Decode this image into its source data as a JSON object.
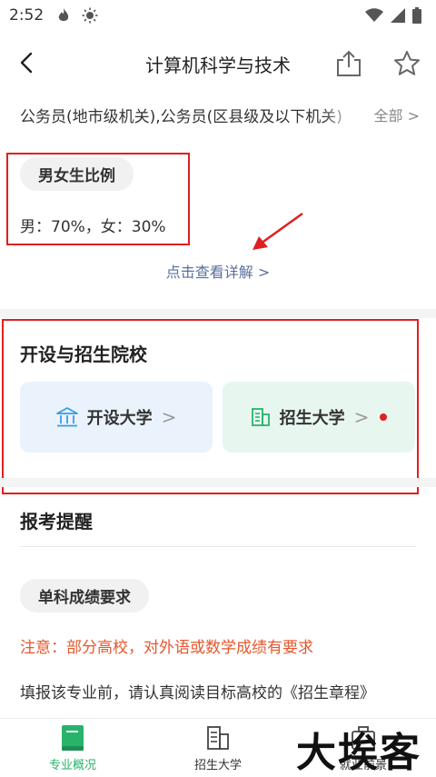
{
  "status_bar": {
    "time": "2:52"
  },
  "header": {
    "title": "计算机科学与技术"
  },
  "career": {
    "text": "公务员(地市级机关),公务员(区县级及以下机关)",
    "all_label": "全部 >"
  },
  "gender": {
    "title": "男女生比例",
    "ratio": "男：70%，女：30%",
    "detail_link": "点击查看详解 >"
  },
  "schools": {
    "title": "开设与招生院校",
    "open_label": "开设大学",
    "enroll_label": "招生大学",
    "chevron": ">"
  },
  "reminder": {
    "title": "报考提醒",
    "subject_pill": "单科成绩要求",
    "notice": "注意：部分高校，对外语或数学成绩有要求",
    "read": "填报该专业前，请认真阅读目标高校的《招生章程》"
  },
  "bottom_nav": {
    "items": [
      {
        "label": "专业概况",
        "icon": "book-icon",
        "active": true
      },
      {
        "label": "招生大学",
        "icon": "building-icon",
        "active": false
      },
      {
        "label": "就业前景",
        "icon": "briefcase-icon",
        "active": false
      }
    ]
  },
  "watermark": "大埃客",
  "colors": {
    "accent": "#28b36b",
    "annotation": "#e02020",
    "notice": "#e4572e",
    "link": "#5b6f9e"
  }
}
